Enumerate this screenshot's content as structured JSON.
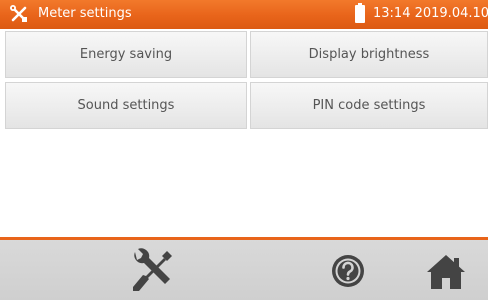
{
  "titlebar": {
    "title": "Meter settings",
    "datetime": "13:14 2019.04.10",
    "icon": "tools-icon",
    "battery_icon": "battery-icon"
  },
  "menu": {
    "energy_saving": "Energy saving",
    "display_brightness": "Display brightness",
    "sound_settings": "Sound settings",
    "pin_code_settings": "PIN code settings"
  },
  "bottombar": {
    "tools_icon": "tools-icon",
    "help_icon": "help-icon",
    "home_icon": "home-icon"
  },
  "colors": {
    "accent": "#e8641a",
    "button_bg": "#ececec",
    "bar_bg": "#d4d4d4",
    "icon_dark": "#444444"
  }
}
